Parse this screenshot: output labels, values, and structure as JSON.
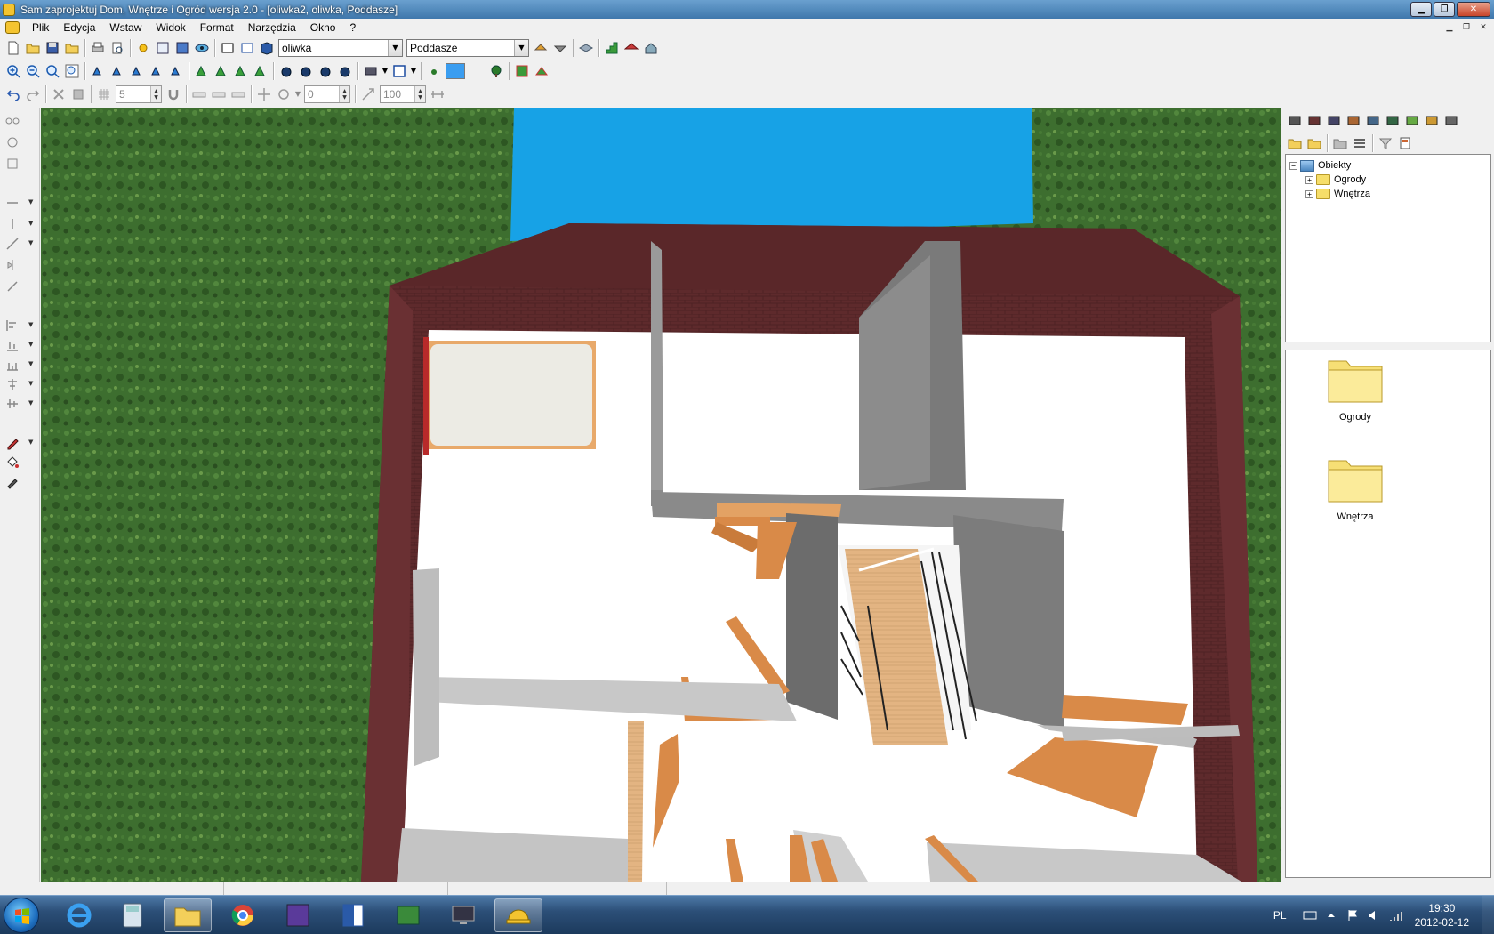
{
  "window": {
    "title": "Sam zaprojektuj Dom, Wnętrze i Ogród wersja 2.0 - [oliwka2, oliwka, Poddasze]"
  },
  "menu": {
    "items": [
      "Plik",
      "Edycja",
      "Wstaw",
      "Widok",
      "Format",
      "Narzędzia",
      "Okno",
      "?"
    ]
  },
  "toolbar": {
    "project_combo": "oliwka",
    "level_combo": "Poddasze",
    "grid_step": "5",
    "angle_value": "0",
    "zoom_percent": "100",
    "fill_color": "#3a9df0"
  },
  "tree": {
    "root": "Obiekty",
    "children": [
      "Ogrody",
      "Wnętrza"
    ]
  },
  "files": {
    "items": [
      "Ogrody",
      "Wnętrza"
    ]
  },
  "taskbar": {
    "language": "PL",
    "time": "19:30",
    "date": "2012-02-12"
  },
  "colors": {
    "grass": "#3b6e2e",
    "sky": "#17a2e6",
    "roof_brick": "#5e2a2c",
    "wall_gray": "#7a7a7a",
    "wood": "#d98a48"
  }
}
